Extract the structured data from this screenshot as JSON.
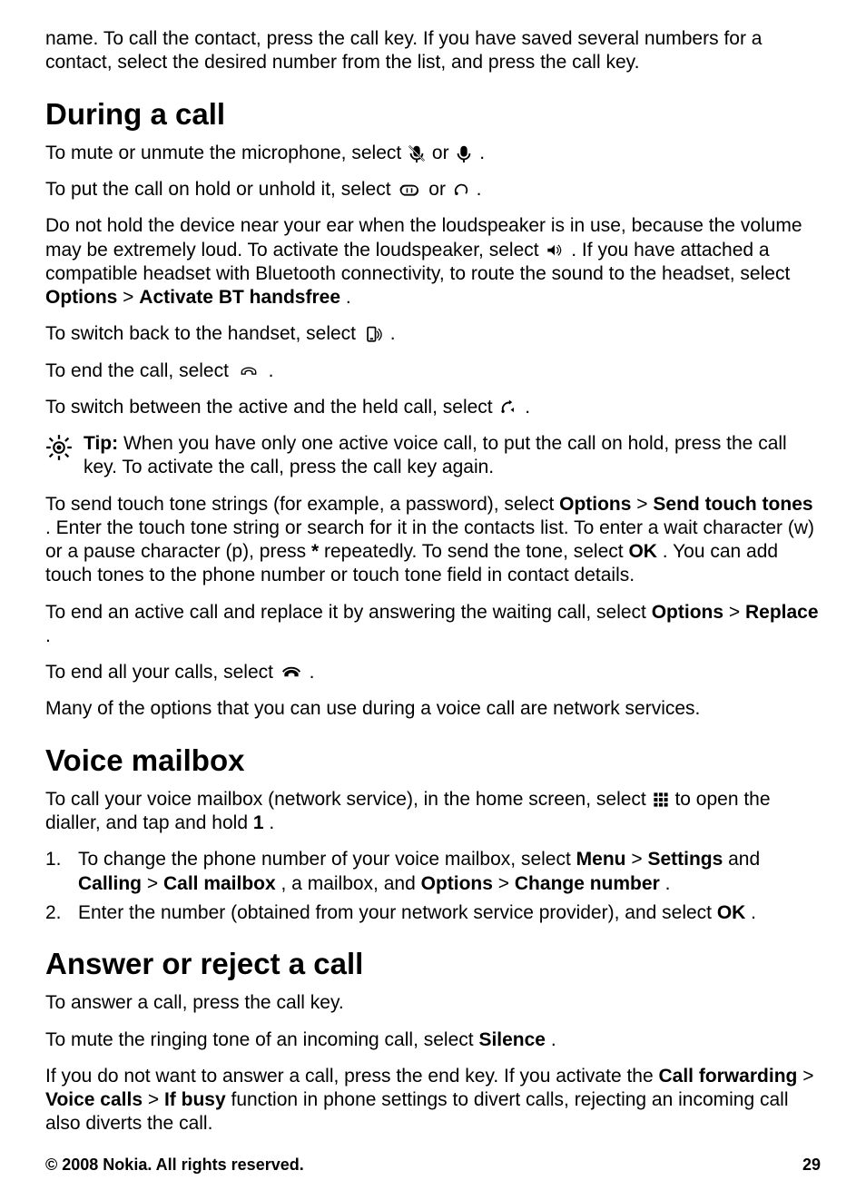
{
  "intro_text": "name. To call the contact, press the call key. If you have saved several numbers for a contact, select the desired number from the list, and press the call key.",
  "during": {
    "heading": "During a call",
    "mute_pre": "To mute or unmute the microphone, select ",
    "mute_or": " or ",
    "mute_post": ".",
    "hold_pre": "To put the call on hold or unhold it, select ",
    "hold_or": " or ",
    "hold_post": ".",
    "loud_pre": "Do not hold the device near your ear when the loudspeaker is in use, because the volume may be extremely loud. To activate the loudspeaker, select ",
    "loud_mid": ". If you have attached a compatible headset with Bluetooth connectivity, to route the sound to the headset, select ",
    "options_label": "Options",
    "sep": " > ",
    "activate_bt": "Activate BT handsfree",
    "loud_post": ".",
    "handset_pre": "To switch back to the handset, select ",
    "handset_post": ".",
    "end_pre": "To end the call, select ",
    "end_post": ".",
    "switch_pre": "To switch between the active and the held call, select ",
    "switch_post": ".",
    "tip_label": "Tip:",
    "tip_body": " When you have only one active voice call, to put the call on hold, press the call key. To activate the call, press the call key again.",
    "touch_pre": "To send touch tone strings (for example, a password), select ",
    "send_touch_tones": "Send touch tones",
    "touch_mid1": ". Enter the touch tone string or search for it in the contacts list. To enter a wait character (w) or a pause character (p), press ",
    "star": "*",
    "touch_mid2": " repeatedly. To send the tone, select ",
    "ok": "OK",
    "touch_post": ". You can add touch tones to the phone number or touch tone field in contact details.",
    "replace_pre": "To end an active call and replace it by answering the waiting call, select ",
    "replace": "Replace",
    "replace_post": ".",
    "endall_pre": "To end all your calls, select ",
    "endall_post": ".",
    "note": "Many of the options that you can use during a voice call are network services."
  },
  "voicemail": {
    "heading": "Voice mailbox",
    "intro_pre": "To call your voice mailbox (network service), in the home screen, select ",
    "intro_mid": " to open the dialler, and tap and hold ",
    "one": "1",
    "intro_post": ".",
    "item1_num": "1.",
    "item1_pre": "To change the phone number of your voice mailbox, select ",
    "menu": "Menu",
    "settings": "Settings",
    "item1_and1": " and ",
    "calling": "Calling",
    "call_mailbox": "Call mailbox",
    "item1_mid": ", a mailbox, and ",
    "change_number": "Change number",
    "item1_post": ".",
    "item2_num": "2.",
    "item2_pre": "Enter the number (obtained from your network service provider), and select ",
    "item2_post": "."
  },
  "answer": {
    "heading": "Answer or reject a call",
    "p1": "To answer a call, press the call key.",
    "p2_pre": "To mute the ringing tone of an incoming call, select ",
    "silence": "Silence",
    "p2_post": ".",
    "p3_pre": "If you do not want to answer a call, press the end key. If you activate the ",
    "call_fwd": "Call forwarding",
    "voice_calls": "Voice calls",
    "if_busy": "If busy",
    "p3_post": " function in phone settings to divert calls, rejecting an incoming call also diverts the call."
  },
  "footer": {
    "copyright": "© 2008 Nokia. All rights reserved.",
    "page": "29"
  }
}
